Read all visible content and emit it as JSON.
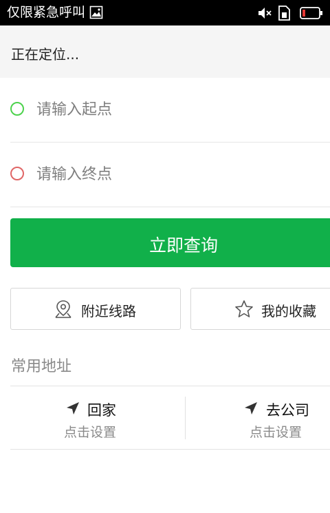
{
  "status_bar": {
    "carrier_text": "仅限紧急呼叫",
    "icons": [
      "image-icon",
      "muted-speaker-icon",
      "sim-icon",
      "battery-low-icon"
    ],
    "battery_color": "#e53935"
  },
  "location": {
    "status_text": "正在定位..."
  },
  "route_form": {
    "start": {
      "placeholder": "请输入起点",
      "value": "",
      "marker_color": "#4cd24c"
    },
    "end": {
      "placeholder": "请输入终点",
      "value": "",
      "marker_color": "#e06666"
    },
    "search_label": "立即查询",
    "search_color": "#11b04a"
  },
  "quick_actions": [
    {
      "icon": "location-pin-icon",
      "label": "附近线路"
    },
    {
      "icon": "star-icon",
      "label": "我的收藏"
    }
  ],
  "common_addresses": {
    "title": "常用地址",
    "items": [
      {
        "icon": "navigation-arrow-icon",
        "name": "回家",
        "hint": "点击设置"
      },
      {
        "icon": "navigation-arrow-icon",
        "name": "去公司",
        "hint": "点击设置"
      }
    ]
  }
}
